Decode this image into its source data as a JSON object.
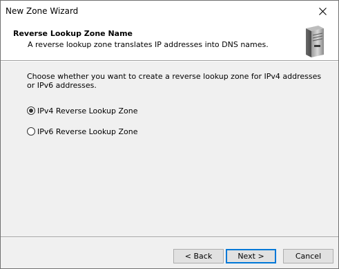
{
  "window": {
    "title": "New Zone Wizard"
  },
  "header": {
    "title": "Reverse Lookup Zone Name",
    "subtitle": "A reverse lookup zone translates IP addresses into DNS names.",
    "icon": "server-icon"
  },
  "content": {
    "instruction": "Choose whether you want to create a reverse lookup zone for IPv4 addresses or IPv6 addresses.",
    "options": [
      {
        "label": "IPv4 Reverse Lookup Zone",
        "selected": true
      },
      {
        "label": "IPv6 Reverse Lookup Zone",
        "selected": false
      }
    ]
  },
  "buttons": {
    "back": "< Back",
    "next": "Next >",
    "cancel": "Cancel"
  },
  "colors": {
    "accent": "#0078d7",
    "dialog_bg": "#f0f0f0",
    "header_bg": "#ffffff"
  }
}
